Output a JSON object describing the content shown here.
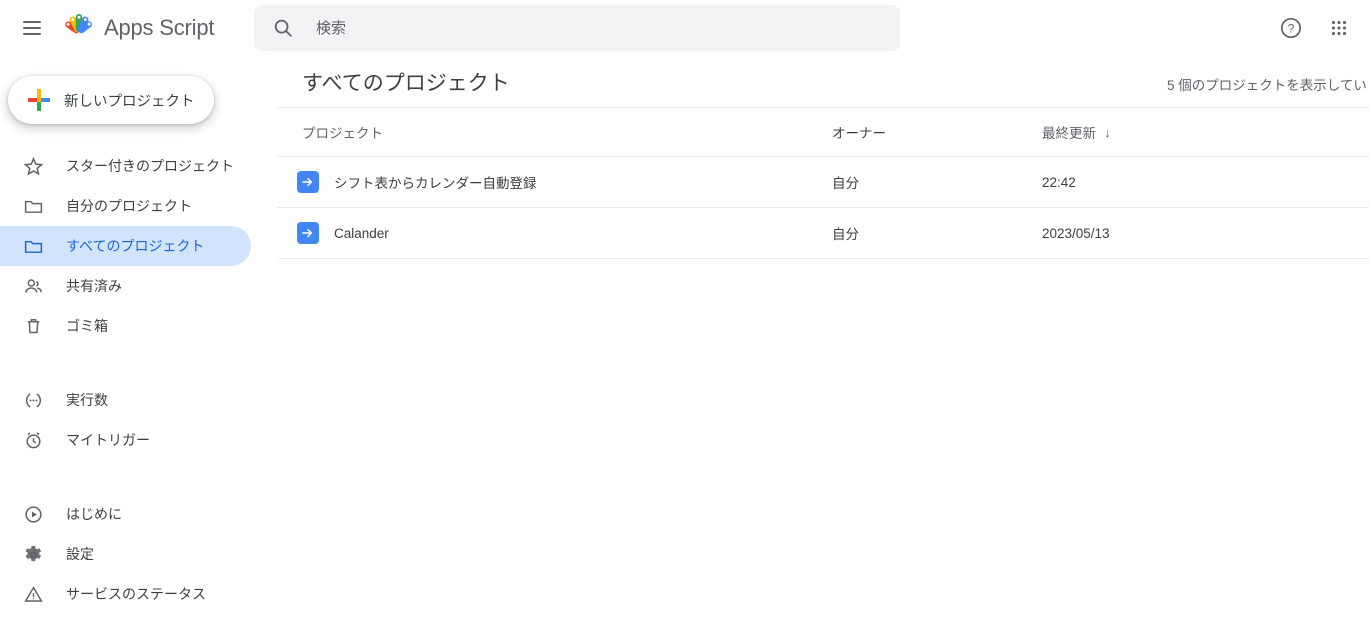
{
  "topbar": {
    "menu_icon": "hamburger-menu-icon",
    "brand": "Apps Script",
    "brand_logo_icon": "apps-script-logo-icon",
    "search": {
      "icon": "search-icon",
      "placeholder": "検索",
      "value": ""
    },
    "help_icon": "help-circle-icon",
    "apps_icon": "apps-grid-icon"
  },
  "sidebar": {
    "new_project": {
      "label": "新しいプロジェクト",
      "icon": "google-plus-icon"
    },
    "groups": [
      {
        "items": [
          {
            "label": "スター付きのプロジェクト",
            "icon": "star-icon",
            "active": false
          },
          {
            "label": "自分のプロジェクト",
            "icon": "folder-icon",
            "active": false
          },
          {
            "label": "すべてのプロジェクト",
            "icon": "folder-icon",
            "active": true
          },
          {
            "label": "共有済み",
            "icon": "people-icon",
            "active": false
          },
          {
            "label": "ゴミ箱",
            "icon": "trash-icon",
            "active": false
          }
        ]
      },
      {
        "items": [
          {
            "label": "実行数",
            "icon": "executions-icon",
            "active": false
          },
          {
            "label": "マイトリガー",
            "icon": "alarm-clock-icon",
            "active": false
          }
        ]
      },
      {
        "items": [
          {
            "label": "はじめに",
            "icon": "play-circle-icon",
            "active": false
          },
          {
            "label": "設定",
            "icon": "gear-icon",
            "active": false
          },
          {
            "label": "サービスのステータス",
            "icon": "warning-triangle-icon",
            "active": false
          }
        ]
      }
    ]
  },
  "main": {
    "title": "すべてのプロジェクト",
    "count_text": "5 個のプロジェクトを表示してい",
    "columns": {
      "project": "プロジェクト",
      "owner": "オーナー",
      "updated": "最終更新",
      "sort_arrow": "↓"
    },
    "rows": [
      {
        "icon": "project-arrow-icon",
        "name": "シフト表からカレンダー自動登録",
        "owner": "自分",
        "updated": "22:42"
      },
      {
        "icon": "project-arrow-icon",
        "name": "Calander",
        "owner": "自分",
        "updated": "2023/05/13"
      }
    ]
  },
  "colors": {
    "accent_blue": "#1967d2",
    "selected_pill": "#d2e3fc",
    "project_icon_blue": "#4285f4",
    "search_bg": "#f1f3f4",
    "text_primary": "#3c4043",
    "text_secondary": "#5f6368",
    "divider": "#e8eaed"
  }
}
